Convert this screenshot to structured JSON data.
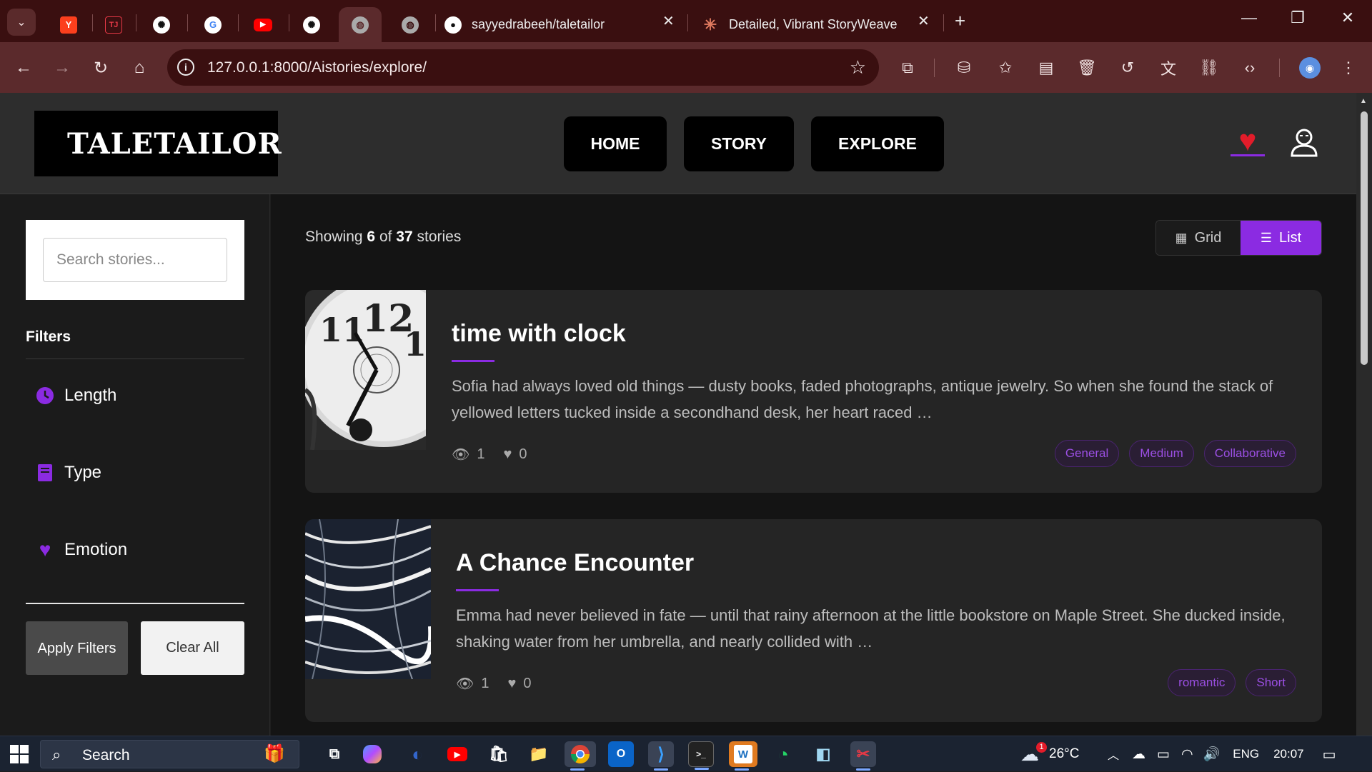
{
  "browser": {
    "tabs": [
      {
        "title": "",
        "icon": "yandex-icon"
      },
      {
        "title": "",
        "icon": "tj-icon"
      },
      {
        "title": "",
        "icon": "openai-icon"
      },
      {
        "title": "",
        "icon": "google-icon"
      },
      {
        "title": "",
        "icon": "youtube-icon"
      },
      {
        "title": "",
        "icon": "openai-icon"
      },
      {
        "title": "",
        "icon": "globe-icon",
        "active": true
      },
      {
        "title": "",
        "icon": "globe-icon"
      },
      {
        "title": "sayyedrabeeh/taletailor",
        "icon": "github-icon"
      },
      {
        "title": "Detailed, Vibrant StoryWeave R",
        "icon": "claude-icon"
      }
    ],
    "url": "127.0.0.1:8000/Aistories/explore/"
  },
  "site": {
    "logo": "TALETAILOR",
    "nav": [
      "HOME",
      "STORY",
      "EXPLORE"
    ],
    "colors": {
      "accent": "#8b2be2",
      "heart": "#e21c2a"
    }
  },
  "sidebar": {
    "search_placeholder": "Search stories...",
    "filters_title": "Filters",
    "filters": [
      {
        "label": "Length",
        "icon": "clock-icon"
      },
      {
        "label": "Type",
        "icon": "book-icon"
      },
      {
        "label": "Emotion",
        "icon": "heart-icon"
      }
    ],
    "apply_label": "Apply Filters",
    "clear_label": "Clear All"
  },
  "main": {
    "showing_prefix": "Showing",
    "showing_count": "6",
    "showing_of": "of",
    "showing_total": "37",
    "showing_suffix": "stories",
    "view_grid": "Grid",
    "view_list": "List",
    "stories": [
      {
        "title": "time with clock",
        "excerpt": "Sofia had always loved old things — dusty books, faded photographs, antique jewelry. So when she found the stack of yellowed letters tucked inside a secondhand desk, her heart raced …",
        "views": "1",
        "likes": "0",
        "tags": [
          "General",
          "Medium",
          "Collaborative"
        ]
      },
      {
        "title": "A Chance Encounter",
        "excerpt": "Emma had never believed in fate — until that rainy afternoon at the little bookstore on Maple Street. She ducked inside, shaking water from her umbrella, and nearly collided with …",
        "views": "1",
        "likes": "0",
        "tags": [
          "romantic",
          "Short"
        ]
      }
    ]
  },
  "taskbar": {
    "search": "Search",
    "weather": "26°C",
    "weather_badge": "1",
    "lang": "ENG",
    "time": "20:07"
  }
}
